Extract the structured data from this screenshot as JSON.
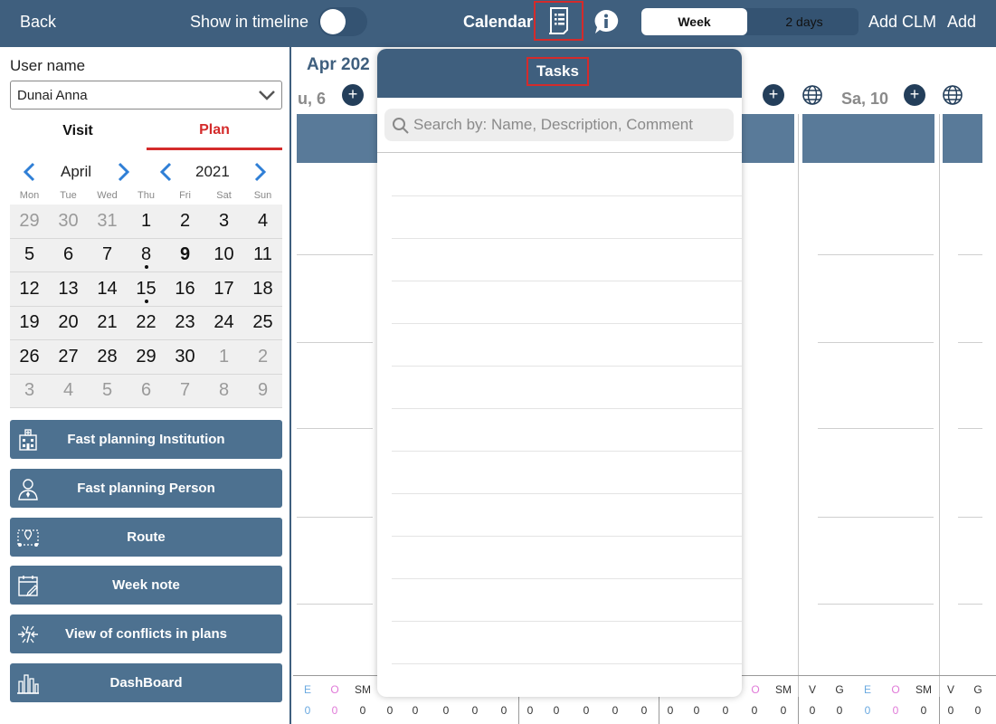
{
  "topbar": {
    "back": "Back",
    "show_in_timeline": "Show in timeline",
    "calendar": "Calendar",
    "view_week": "Week",
    "view_2days": "2 days",
    "add_clm": "Add CLM",
    "add": "Add"
  },
  "sidebar": {
    "user_label": "User name",
    "user_value": "Dunai Anna",
    "tabs": {
      "visit": "Visit",
      "plan": "Plan"
    },
    "mini_calendar": {
      "month": "April",
      "year": "2021",
      "weekdays": [
        "Mon",
        "Tue",
        "Wed",
        "Thu",
        "Fri",
        "Sat",
        "Sun"
      ],
      "weeks": [
        [
          {
            "d": "29",
            "out": true
          },
          {
            "d": "30",
            "out": true
          },
          {
            "d": "31",
            "out": true
          },
          {
            "d": "1"
          },
          {
            "d": "2"
          },
          {
            "d": "3"
          },
          {
            "d": "4"
          }
        ],
        [
          {
            "d": "5"
          },
          {
            "d": "6"
          },
          {
            "d": "7"
          },
          {
            "d": "8",
            "dot": true
          },
          {
            "d": "9",
            "today": true
          },
          {
            "d": "10"
          },
          {
            "d": "11"
          }
        ],
        [
          {
            "d": "12"
          },
          {
            "d": "13"
          },
          {
            "d": "14"
          },
          {
            "d": "15",
            "dot": true
          },
          {
            "d": "16"
          },
          {
            "d": "17"
          },
          {
            "d": "18"
          }
        ],
        [
          {
            "d": "19"
          },
          {
            "d": "20"
          },
          {
            "d": "21"
          },
          {
            "d": "22"
          },
          {
            "d": "23"
          },
          {
            "d": "24"
          },
          {
            "d": "25"
          }
        ],
        [
          {
            "d": "26"
          },
          {
            "d": "27"
          },
          {
            "d": "28"
          },
          {
            "d": "29"
          },
          {
            "d": "30"
          },
          {
            "d": "1",
            "out": true
          },
          {
            "d": "2",
            "out": true
          }
        ],
        [
          {
            "d": "3",
            "out": true
          },
          {
            "d": "4",
            "out": true
          },
          {
            "d": "5",
            "out": true
          },
          {
            "d": "6",
            "out": true
          },
          {
            "d": "7",
            "out": true
          },
          {
            "d": "8",
            "out": true
          },
          {
            "d": "9",
            "out": true
          }
        ]
      ]
    },
    "actions": [
      {
        "label": "Fast planning Institution",
        "icon": "institution-icon"
      },
      {
        "label": "Fast planning Person",
        "icon": "person-icon"
      },
      {
        "label": "Route",
        "icon": "route-icon"
      },
      {
        "label": "Week note",
        "icon": "note-icon"
      },
      {
        "label": "View of conflicts in plans",
        "icon": "conflict-icon"
      },
      {
        "label": "DashBoard",
        "icon": "dashboard-icon"
      }
    ]
  },
  "main": {
    "month_label": "Apr 202",
    "days": [
      {
        "label": "u, 6"
      },
      {
        "label": "Sa, 10"
      }
    ],
    "legend_codes": [
      "E",
      "O",
      "SM"
    ],
    "legend_codes_full": [
      "V",
      "G",
      "E",
      "O",
      "SM"
    ],
    "counts": "0"
  },
  "tasks_popover": {
    "title": "Tasks",
    "search_placeholder": "Search by: Name, Description, Comment"
  },
  "colors": {
    "header": "#3f5f7e",
    "accent_red": "#d42b2b",
    "button": "#4d7190",
    "legend_e": "#6aa9e0",
    "legend_o": "#e07ad8"
  }
}
